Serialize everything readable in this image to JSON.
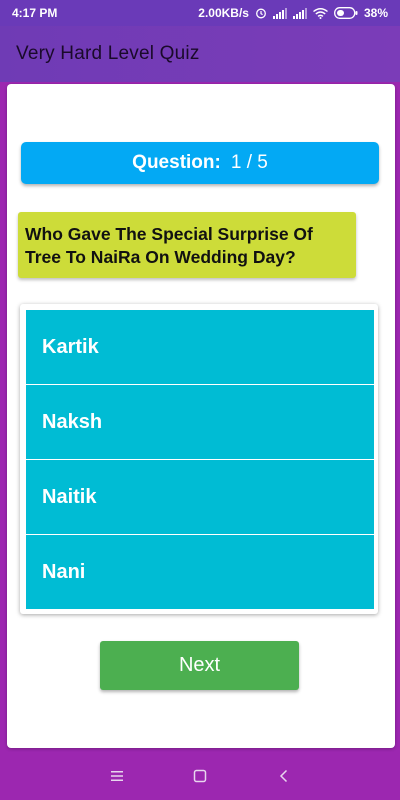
{
  "status_bar": {
    "time": "4:17 PM",
    "network_speed": "2.00KB/s",
    "battery": "38%",
    "icons": [
      "alarm-icon",
      "signal-icon",
      "signal-icon",
      "wifi-icon",
      "battery-icon"
    ]
  },
  "app_bar": {
    "title": "Very Hard Level Quiz"
  },
  "quiz": {
    "counter_label": "Question:",
    "counter_value": "1 / 5",
    "question": "Who Gave The Special Surprise Of Tree To NaiRa On Wedding Day?",
    "options": [
      "Kartik",
      "Naksh",
      "Naitik",
      "Nani"
    ],
    "next_label": "Next"
  },
  "nav_bar": {
    "icons": [
      "menu-icon",
      "home-icon",
      "back-icon"
    ]
  },
  "colors": {
    "status_bar": "#6a3ab8",
    "app_bar": "#7b3cb8",
    "counter": "#03a9f4",
    "question_bg": "#cddc39",
    "option_bg": "#00bcd4",
    "next_button": "#4caf50",
    "nav_bar": "#9c27b0"
  }
}
